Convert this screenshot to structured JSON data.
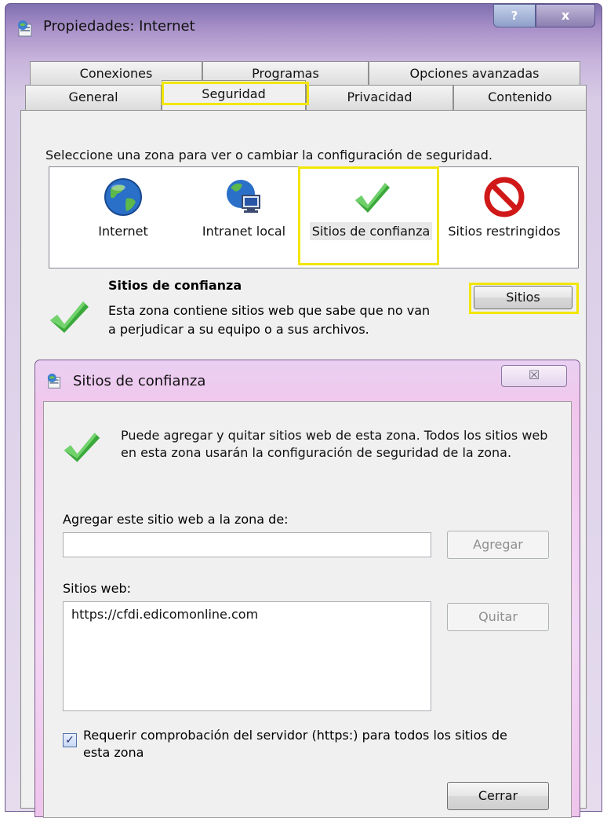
{
  "window": {
    "title": "Propiedades: Internet",
    "help_label": "?",
    "close_label": "x"
  },
  "tabs": {
    "row1": [
      "Conexiones",
      "Programas",
      "Opciones avanzadas"
    ],
    "row2": [
      "General",
      "Seguridad",
      "Privacidad",
      "Contenido"
    ],
    "active": "Seguridad"
  },
  "security": {
    "intro": "Seleccione una zona para ver o cambiar la configuración de seguridad.",
    "zones": [
      {
        "label": "Internet",
        "icon": "globe-icon"
      },
      {
        "label": "Intranet local",
        "icon": "intranet-icon"
      },
      {
        "label": "Sitios de confianza",
        "icon": "checkmark-icon",
        "selected": true
      },
      {
        "label": "Sitios restringidos",
        "icon": "restricted-icon"
      }
    ],
    "zone_title": "Sitios de confianza",
    "zone_desc": "Esta zona contiene sitios web que sabe que no van a perjudicar a su equipo o a sus archivos.",
    "sites_button": "Sitios"
  },
  "dialog": {
    "title": "Sitios de confianza",
    "close_label": "☒",
    "description": "Puede agregar y quitar sitios web de esta zona. Todos los sitios web en esta zona usarán la configuración de seguridad de la zona.",
    "add_label": "Agregar este sitio web a la zona de:",
    "add_input_value": "",
    "add_button": "Agregar",
    "sites_label": "Sitios web:",
    "sites": [
      "https://cfdi.edicomonline.com"
    ],
    "remove_button": "Quitar",
    "require_https_checked": true,
    "require_https_label": "Requerir comprobación del servidor (https:) para todos los sitios de esta zona",
    "close_button": "Cerrar"
  },
  "colors": {
    "highlight": "#f2e600",
    "check_green": "#3aa83a",
    "restricted_red": "#d01818"
  }
}
